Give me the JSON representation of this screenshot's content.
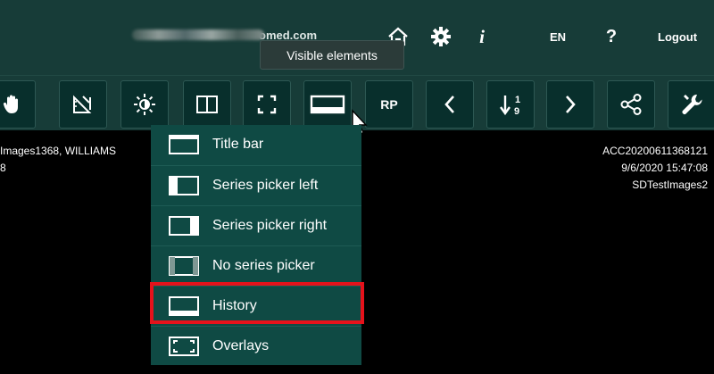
{
  "header": {
    "user_email_visible": "omed.com",
    "language": "EN",
    "help_label": "?",
    "info_label": "i",
    "logout_label": "Logout"
  },
  "tooltip": {
    "text": "Visible elements"
  },
  "toolbar": {
    "buttons": [
      {
        "name": "pan-tool",
        "icon": "hand-icon"
      },
      {
        "name": "measure-tool",
        "icon": "ruler-icon"
      },
      {
        "name": "brightness-tool",
        "icon": "brightness-icon"
      },
      {
        "name": "layout-tool",
        "icon": "split-layout-icon"
      },
      {
        "name": "fullscreen-tool",
        "icon": "expand-icon"
      },
      {
        "name": "visible-elements",
        "icon": "title-bar-layout-icon"
      },
      {
        "name": "rp",
        "label": "RP"
      },
      {
        "name": "previous",
        "icon": "chevron-left-icon"
      },
      {
        "name": "sort",
        "icon": "sort-numeric-icon"
      },
      {
        "name": "next",
        "icon": "chevron-right-icon"
      },
      {
        "name": "share",
        "icon": "share-icon"
      },
      {
        "name": "tools",
        "icon": "wrench-icon"
      }
    ],
    "rp_label": "RP"
  },
  "patient": {
    "left_line1": "Images1368, WILLIAMS",
    "left_line2": "8"
  },
  "study": {
    "accession": "ACC20200611368121",
    "datetime": "9/6/2020 15:47:08",
    "institution": "SDTestImages2"
  },
  "menu": {
    "items": [
      {
        "label": "Title bar",
        "icon": "title-bar-icon"
      },
      {
        "label": "Series picker left",
        "icon": "series-picker-left-icon"
      },
      {
        "label": "Series picker right",
        "icon": "series-picker-right-icon"
      },
      {
        "label": "No series picker",
        "icon": "no-series-picker-icon"
      },
      {
        "label": "History",
        "icon": "history-icon",
        "highlighted": true
      },
      {
        "label": "Overlays",
        "icon": "overlays-icon"
      }
    ]
  },
  "colors": {
    "header_bg": "#173c38",
    "button_bg": "#082f2c",
    "menu_bg": "#0f4a44",
    "highlight": "#e5121b"
  }
}
